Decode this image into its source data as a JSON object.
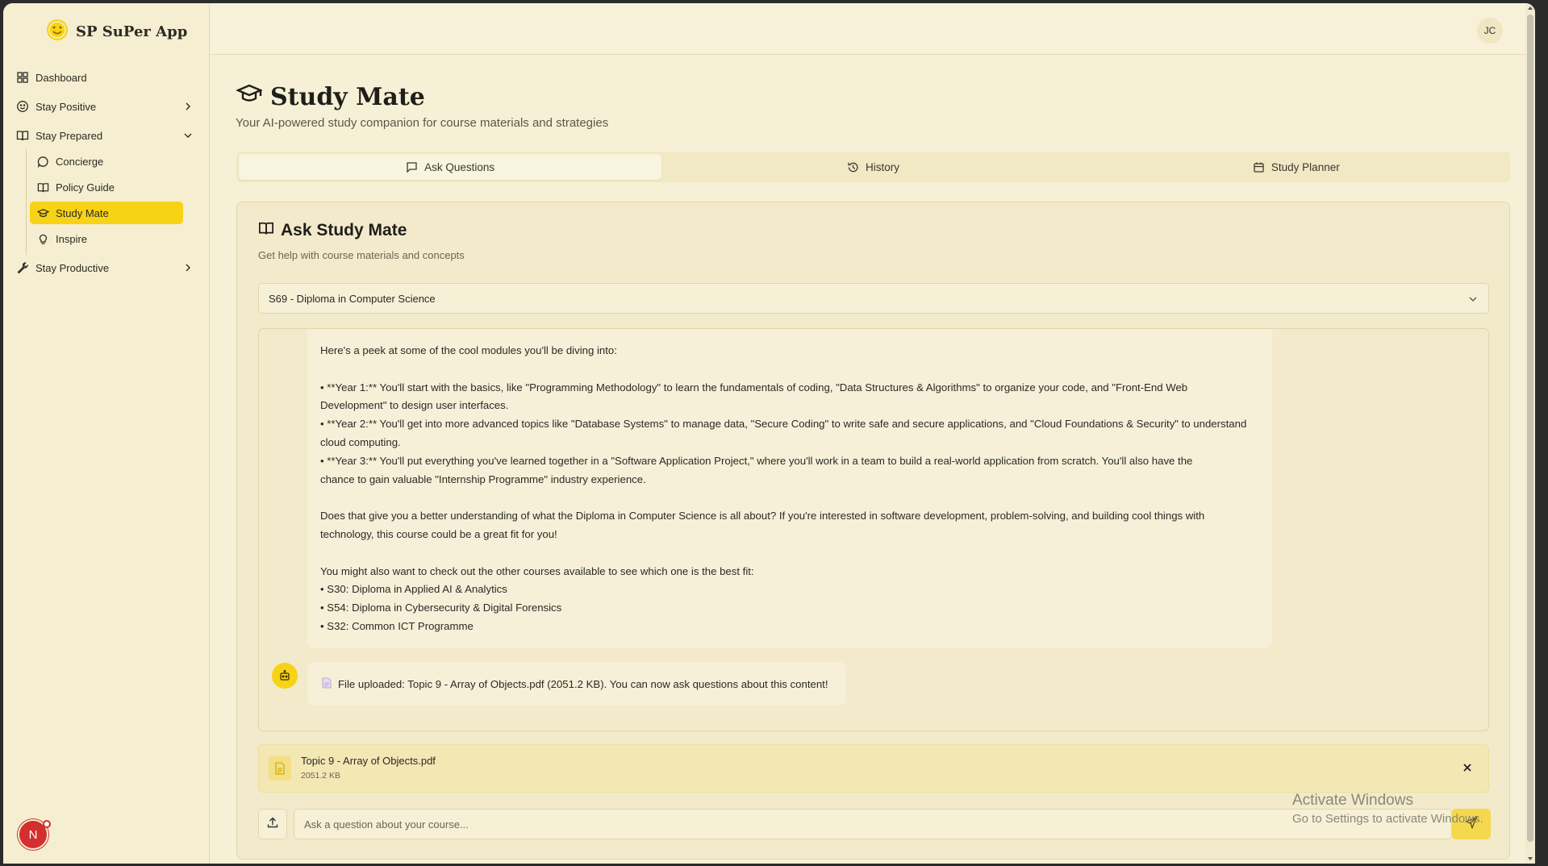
{
  "app": {
    "name": "SP SuPer App"
  },
  "colors": {
    "accent": "#f7d315",
    "background": "#f6f0d6",
    "avatar_red": "#d32f2f"
  },
  "sidebar": {
    "items": [
      {
        "label": "Dashboard",
        "icon": "grid-icon"
      },
      {
        "label": "Stay Positive",
        "icon": "smile-icon",
        "expanded": false
      },
      {
        "label": "Stay Prepared",
        "icon": "book-open-icon",
        "expanded": true
      },
      {
        "label": "Stay Productive",
        "icon": "wrench-icon",
        "expanded": false
      }
    ],
    "sub_items": [
      {
        "label": "Concierge",
        "icon": "chat-bubble-icon"
      },
      {
        "label": "Policy Guide",
        "icon": "book-open-icon"
      },
      {
        "label": "Study Mate",
        "icon": "graduation-cap-icon",
        "active": true
      },
      {
        "label": "Inspire",
        "icon": "lightbulb-icon"
      }
    ],
    "avatar_initial": "N"
  },
  "topbar": {
    "user_initials": "JC"
  },
  "page": {
    "title": "Study Mate",
    "subtitle": "Your AI-powered study companion for course materials and strategies"
  },
  "tabs": [
    {
      "label": "Ask Questions",
      "icon": "message-square-icon",
      "active": true
    },
    {
      "label": "History",
      "icon": "history-icon"
    },
    {
      "label": "Study Planner",
      "icon": "calendar-icon"
    }
  ],
  "card": {
    "title": "Ask Study Mate",
    "subtitle": "Get help with course materials and concepts",
    "course_select": "S69 - Diploma in Computer Science"
  },
  "chat": {
    "long_message": [
      "Here's a peek at some of the cool modules you'll be diving into:",
      "",
      "•  **Year 1:** You'll start with the basics, like \"Programming Methodology\" to learn the fundamentals of coding, \"Data Structures & Algorithms\" to organize your code, and \"Front-End Web",
      "Development\" to design user interfaces.",
      "•  **Year 2:** You'll get into more advanced topics like \"Database Systems\" to manage data, \"Secure Coding\" to write safe and secure applications, and \"Cloud Foundations & Security\" to understand",
      "cloud computing.",
      "•  **Year 3:** You'll put everything you've learned together in a \"Software Application Project,\" where you'll work in a team to build a real-world application from scratch. You'll also have the",
      "chance to gain valuable \"Internship Programme\" industry experience.",
      "",
      "Does that give you a better understanding of what the Diploma in Computer Science is all about? If you're interested in software development, problem-solving, and building cool things with",
      "technology, this course could be a great fit for you!",
      "",
      "You might also want to check out the other courses available to see which one is the best fit:",
      "•  S30: Diploma in Applied AI & Analytics",
      "•  S54: Diploma in Cybersecurity & Digital Forensics",
      "•  S32: Common ICT Programme"
    ],
    "file_message": "File uploaded: Topic 9 - Array of Objects.pdf (2051.2 KB). You can now ask questions about this content!"
  },
  "attachment": {
    "name": "Topic 9 - Array of Objects.pdf",
    "size": "2051.2 KB"
  },
  "composer": {
    "placeholder": "Ask a question about your course..."
  },
  "watermark": {
    "line1": "Activate Windows",
    "line2": "Go to Settings to activate Windows."
  }
}
